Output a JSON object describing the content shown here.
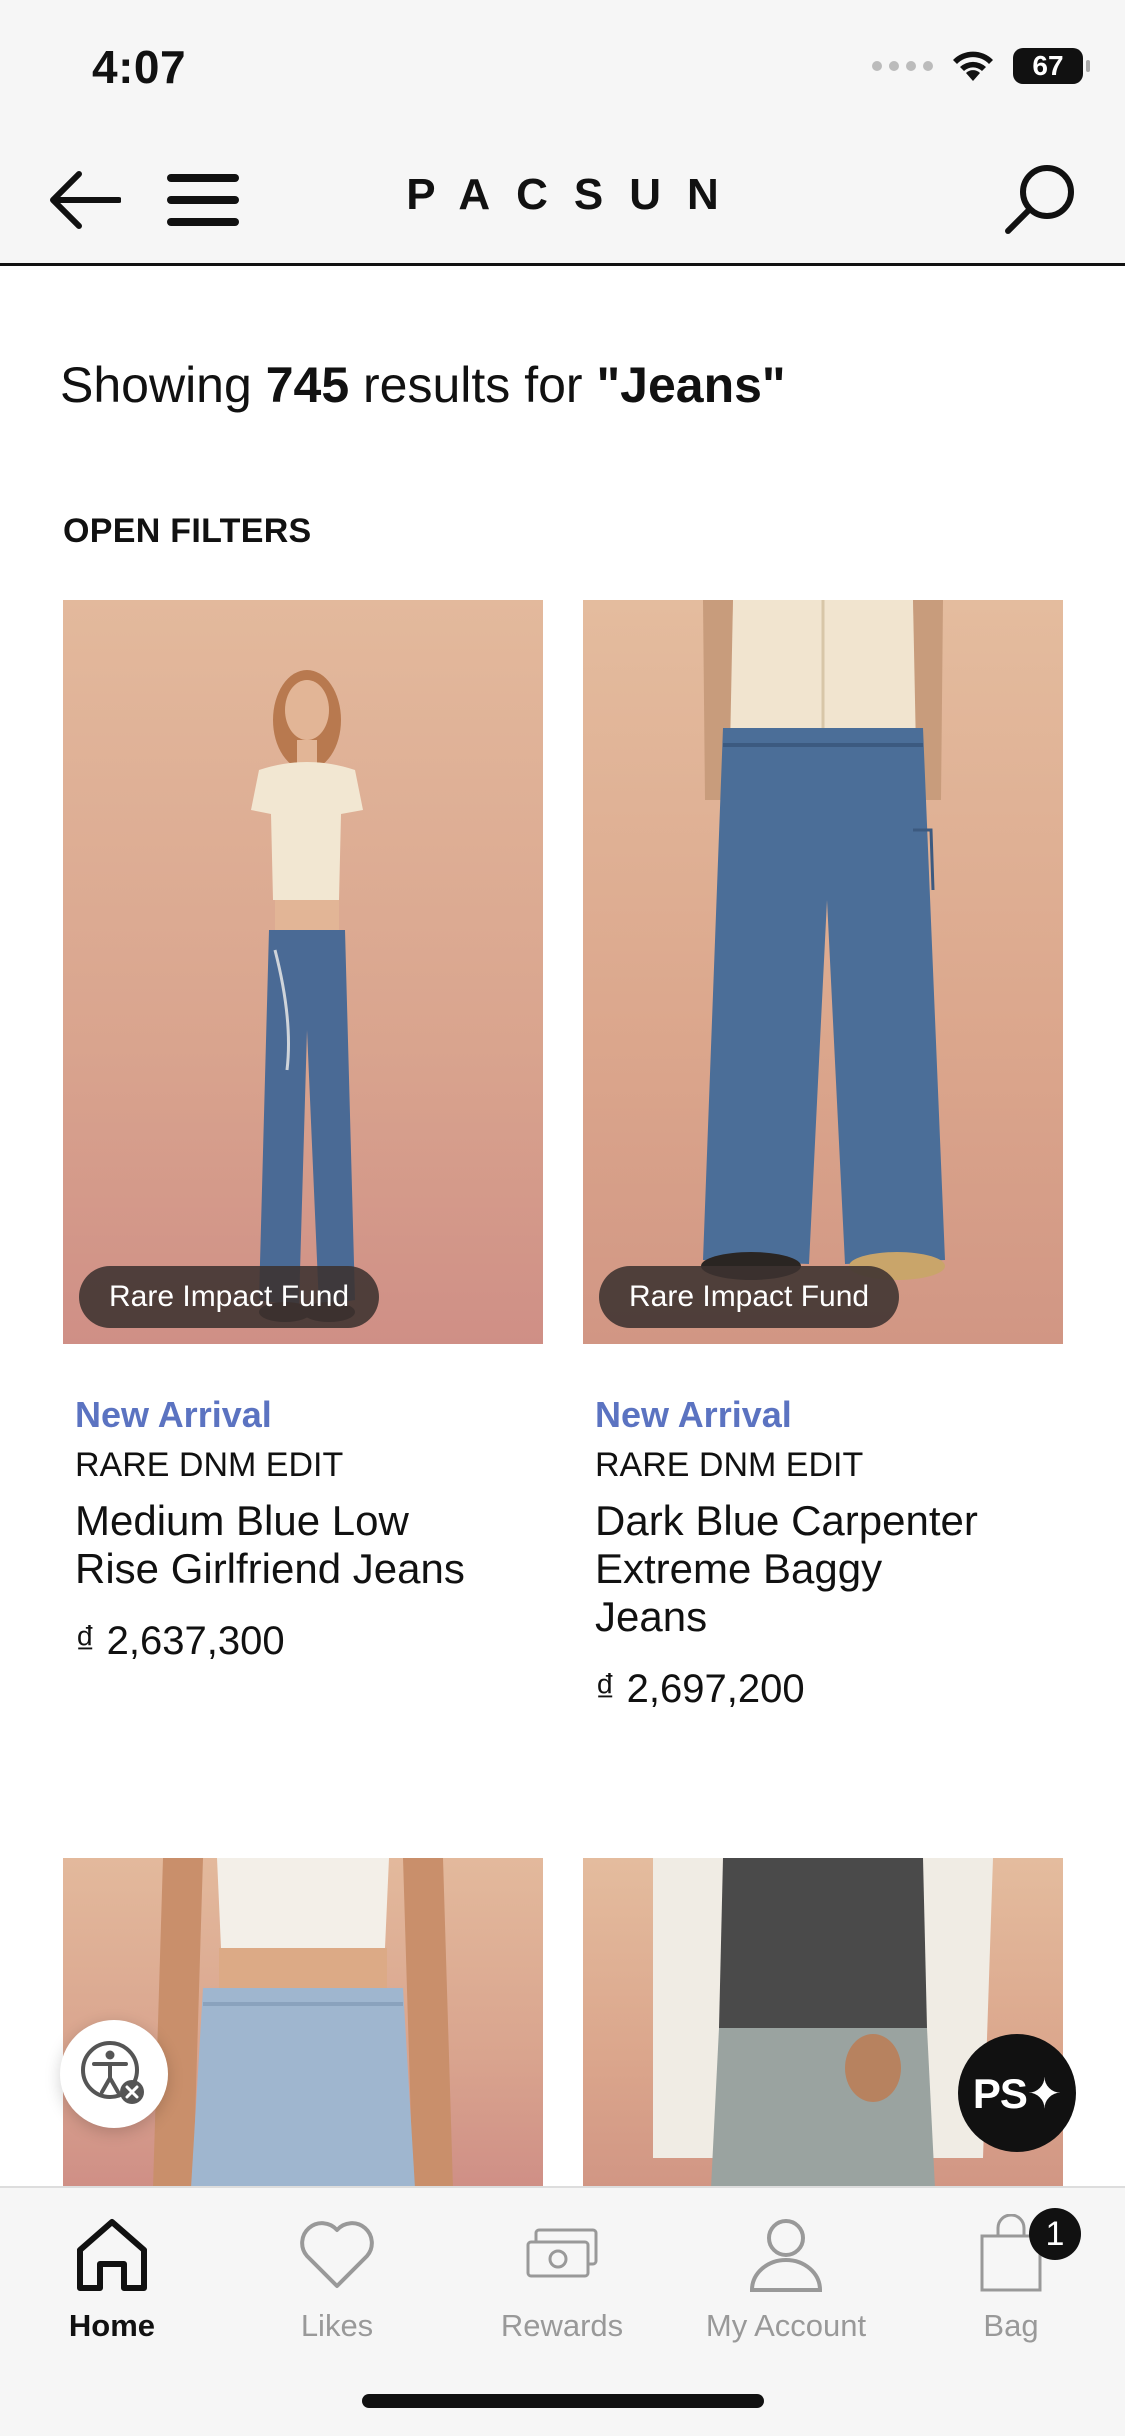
{
  "status_bar": {
    "time": "4:07",
    "battery": "67"
  },
  "header": {
    "logo": "PACSUN"
  },
  "results": {
    "prefix": "Showing ",
    "count": "745",
    "middle": " results for ",
    "query": "\"Jeans\""
  },
  "filters_label": "OPEN FILTERS",
  "products": [
    {
      "badge": "Rare Impact Fund",
      "tag": "New Arrival",
      "brand": "RARE DNM EDIT",
      "name": "Medium Blue Low Rise Girlfriend Jeans",
      "price": "₫ 2,637,300"
    },
    {
      "badge": "Rare Impact Fund",
      "tag": "New Arrival",
      "brand": "RARE DNM EDIT",
      "name": "Dark Blue Carpenter Extreme Baggy Jeans",
      "price": "₫ 2,697,200"
    }
  ],
  "floating": {
    "ps_label": "PS✦"
  },
  "tabbar": {
    "tabs": [
      {
        "label": "Home",
        "icon": "home-icon",
        "active": true
      },
      {
        "label": "Likes",
        "icon": "heart-icon"
      },
      {
        "label": "Rewards",
        "icon": "rewards-icon"
      },
      {
        "label": "My Account",
        "icon": "account-icon"
      },
      {
        "label": "Bag",
        "icon": "bag-icon"
      }
    ],
    "bag_count": "1"
  },
  "colors": {
    "accent": "#5b73c1",
    "header_bg": "#f6f6f6",
    "text": "#111111"
  }
}
